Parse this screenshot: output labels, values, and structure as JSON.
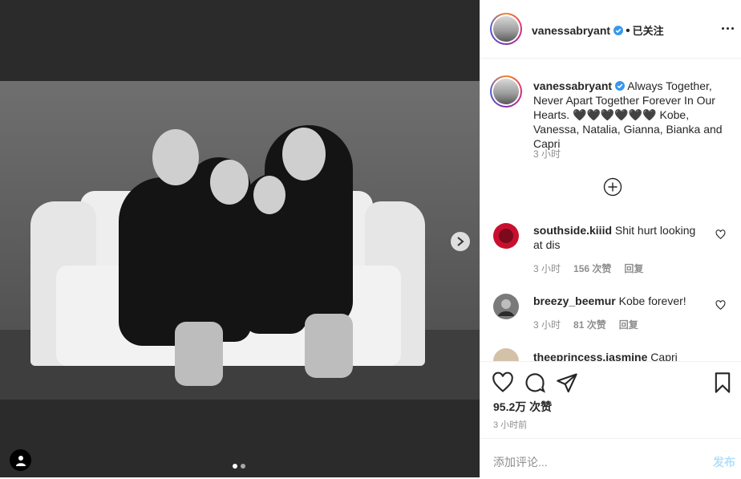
{
  "post": {
    "username": "vanessabryant",
    "separator": "•",
    "follow_status": "已关注",
    "caption": "Always Together, Never Apart Together Forever In Our Hearts. 🖤🖤🖤🖤🖤🖤 Kobe, Vanessa, Natalia, Gianna, Bianka and Capri",
    "caption_time": "3 小时",
    "likes": "95.2万 次赞",
    "post_time": "3 小时前"
  },
  "comments": [
    {
      "username": "southside.kiiid",
      "text": "Shit hurt looking at dis",
      "time": "3 小时",
      "likes": "156 次赞",
      "reply": "回复",
      "avatar_color": "#c8102e"
    },
    {
      "username": "breezy_beemur",
      "text": "Kobe forever!",
      "time": "3 小时",
      "likes": "81 次赞",
      "reply": "回复",
      "avatar_color": "#6d6d6d"
    },
    {
      "username": "theeprincess.jasmine",
      "text": "Capri",
      "time": "",
      "likes": "",
      "reply": "",
      "avatar_color": "#d4c2a8"
    }
  ],
  "composer": {
    "placeholder": "添加评论...",
    "post_label": "发布"
  },
  "carousel": {
    "current": 1,
    "total": 2
  },
  "colors": {
    "accent_blue": "#3897f0",
    "post_disabled": "#b2dffc",
    "text": "#262626",
    "muted": "#8e8e8e"
  },
  "icons": [
    "verified-icon",
    "more-options-icon",
    "load-more-comments-icon",
    "heart-icon",
    "comment-icon",
    "share-icon",
    "save-icon",
    "next-arrow-icon",
    "tagged-user-icon"
  ]
}
